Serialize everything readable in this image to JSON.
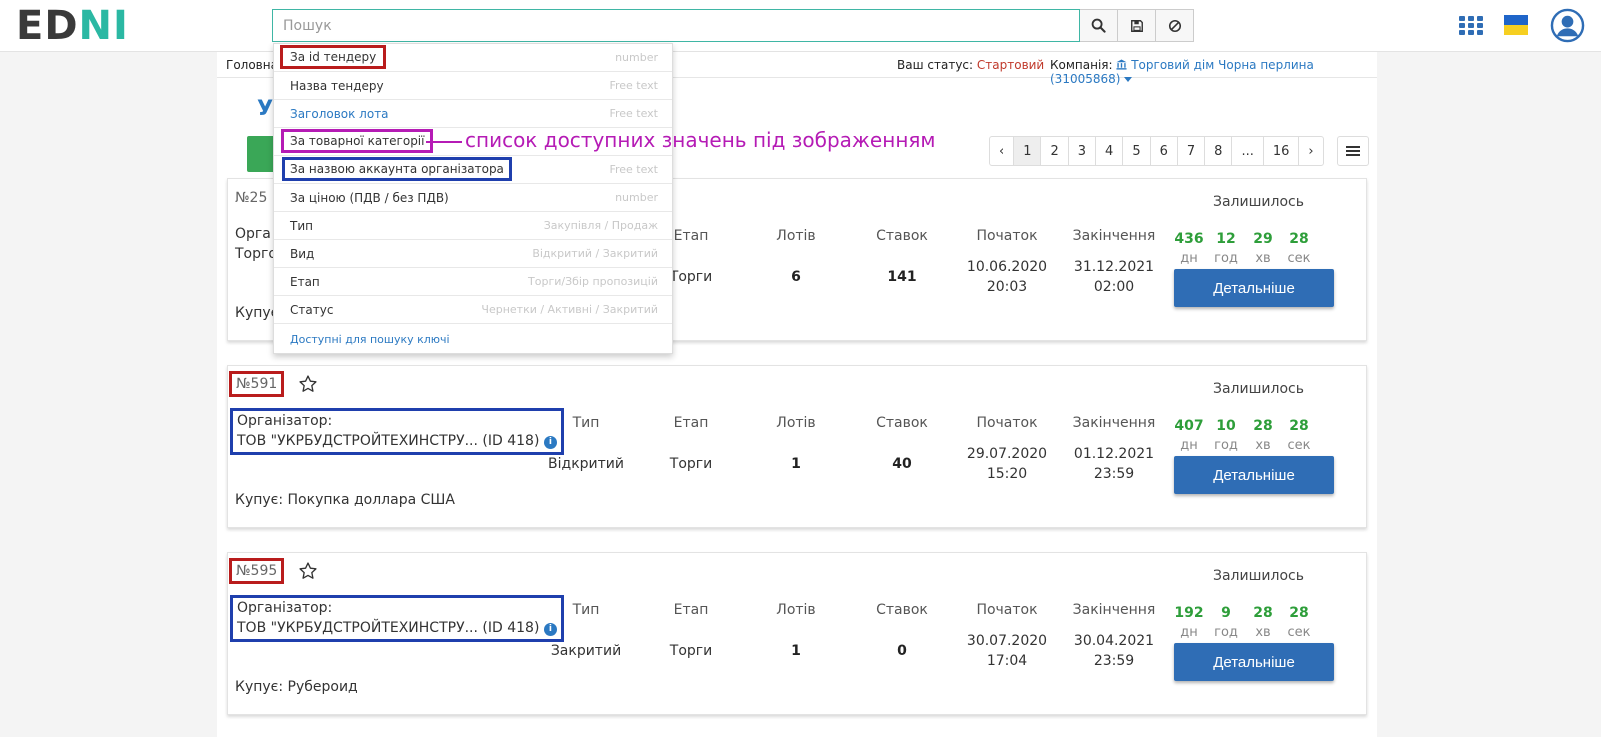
{
  "header": {
    "logo_part1": "ED",
    "logo_part2": "NI",
    "search_placeholder": "Пошук",
    "buttons": [
      "search-icon",
      "save-icon",
      "clear-icon"
    ],
    "icons": [
      "apps-grid-icon",
      "ukraine-flag-icon",
      "user-avatar-icon"
    ]
  },
  "subbar": {
    "breadcrumb": "Головна",
    "status_label": "Ваш статус:",
    "status_value": "Стартовий",
    "company_label": "Компанія:",
    "company_value": "Торговий дім Чорна перлина (31005868)"
  },
  "page": {
    "title_fragment": "Ус"
  },
  "pagination": {
    "prev": "‹",
    "pages": [
      "1",
      "2",
      "3",
      "4",
      "5",
      "6",
      "7",
      "8",
      "...",
      "16"
    ],
    "next": "›",
    "active": "1"
  },
  "dropdown": {
    "items": [
      {
        "label": "За id тендеру",
        "hint": "number"
      },
      {
        "label": "Назва тендеру",
        "hint": "Free text"
      },
      {
        "label": "Заголовок лота",
        "hint": "Free text"
      },
      {
        "label": "За товарної категорії",
        "hint": ""
      },
      {
        "label": "За назвою аккаунта організатора",
        "hint": "Free text"
      },
      {
        "label": "За ціною (ПДВ / без ПДВ)",
        "hint": "number"
      },
      {
        "label": "Тип",
        "hint": "Закупівля / Продаж"
      },
      {
        "label": "Вид",
        "hint": "Відкритий / Закритий"
      },
      {
        "label": "Етап",
        "hint": "Торги/Збір пропозицій"
      },
      {
        "label": "Статус",
        "hint": "Чернетки / Активні / Закритий"
      }
    ],
    "keys_link": "Доступні для пошуку ключі"
  },
  "annotation": {
    "text": "список доступних значень під зображенням",
    "color": "#b51bb5"
  },
  "columns": {
    "type": "Тип",
    "stage": "Етап",
    "lots": "Лотів",
    "bids": "Ставок",
    "start": "Початок",
    "end": "Закінчення",
    "remaining": "Залишилось"
  },
  "timer_units": [
    "дн",
    "год",
    "хв",
    "сек"
  ],
  "detail_button": "Детальніше",
  "auctions": [
    {
      "id": "№25",
      "org_label": "Орга",
      "org_name": "Торго",
      "type": "",
      "stage": "Торги",
      "lots": "6",
      "bids": "141",
      "start_date": "10.06.2020",
      "start_time": "20:03",
      "end_date": "31.12.2021",
      "end_time": "02:00",
      "remaining": [
        "436",
        "12",
        "29",
        "28"
      ],
      "buyer": "Купує"
    },
    {
      "id": "№591",
      "org_label": "Організатор:",
      "org_name": "ТОВ \"УКРБУДСТРОЙТЕХИНСТРУ... (ID 418)",
      "type": "Відкритий",
      "stage": "Торги",
      "lots": "1",
      "bids": "40",
      "start_date": "29.07.2020",
      "start_time": "15:20",
      "end_date": "01.12.2021",
      "end_time": "23:59",
      "remaining": [
        "407",
        "10",
        "28",
        "28"
      ],
      "buyer": "Купує: Покупка доллара США"
    },
    {
      "id": "№595",
      "org_label": "Організатор:",
      "org_name": "ТОВ \"УКРБУДСТРОЙТЕХИНСТРУ... (ID 418)",
      "type": "Закритий",
      "stage": "Торги",
      "lots": "1",
      "bids": "0",
      "start_date": "30.07.2020",
      "start_time": "17:04",
      "end_date": "30.04.2021",
      "end_time": "23:59",
      "remaining": [
        "192",
        "9",
        "28",
        "28"
      ],
      "buyer": "Купує: Рубероид"
    }
  ],
  "colors": {
    "accent": "#2b79c2",
    "primary_button": "#2f6db5",
    "timer_green": "#2e9e3a",
    "status_red": "#c0392b",
    "highlight_red": "#b91c1c",
    "highlight_blue": "#1f3fad",
    "highlight_purple": "#b51bb5"
  }
}
